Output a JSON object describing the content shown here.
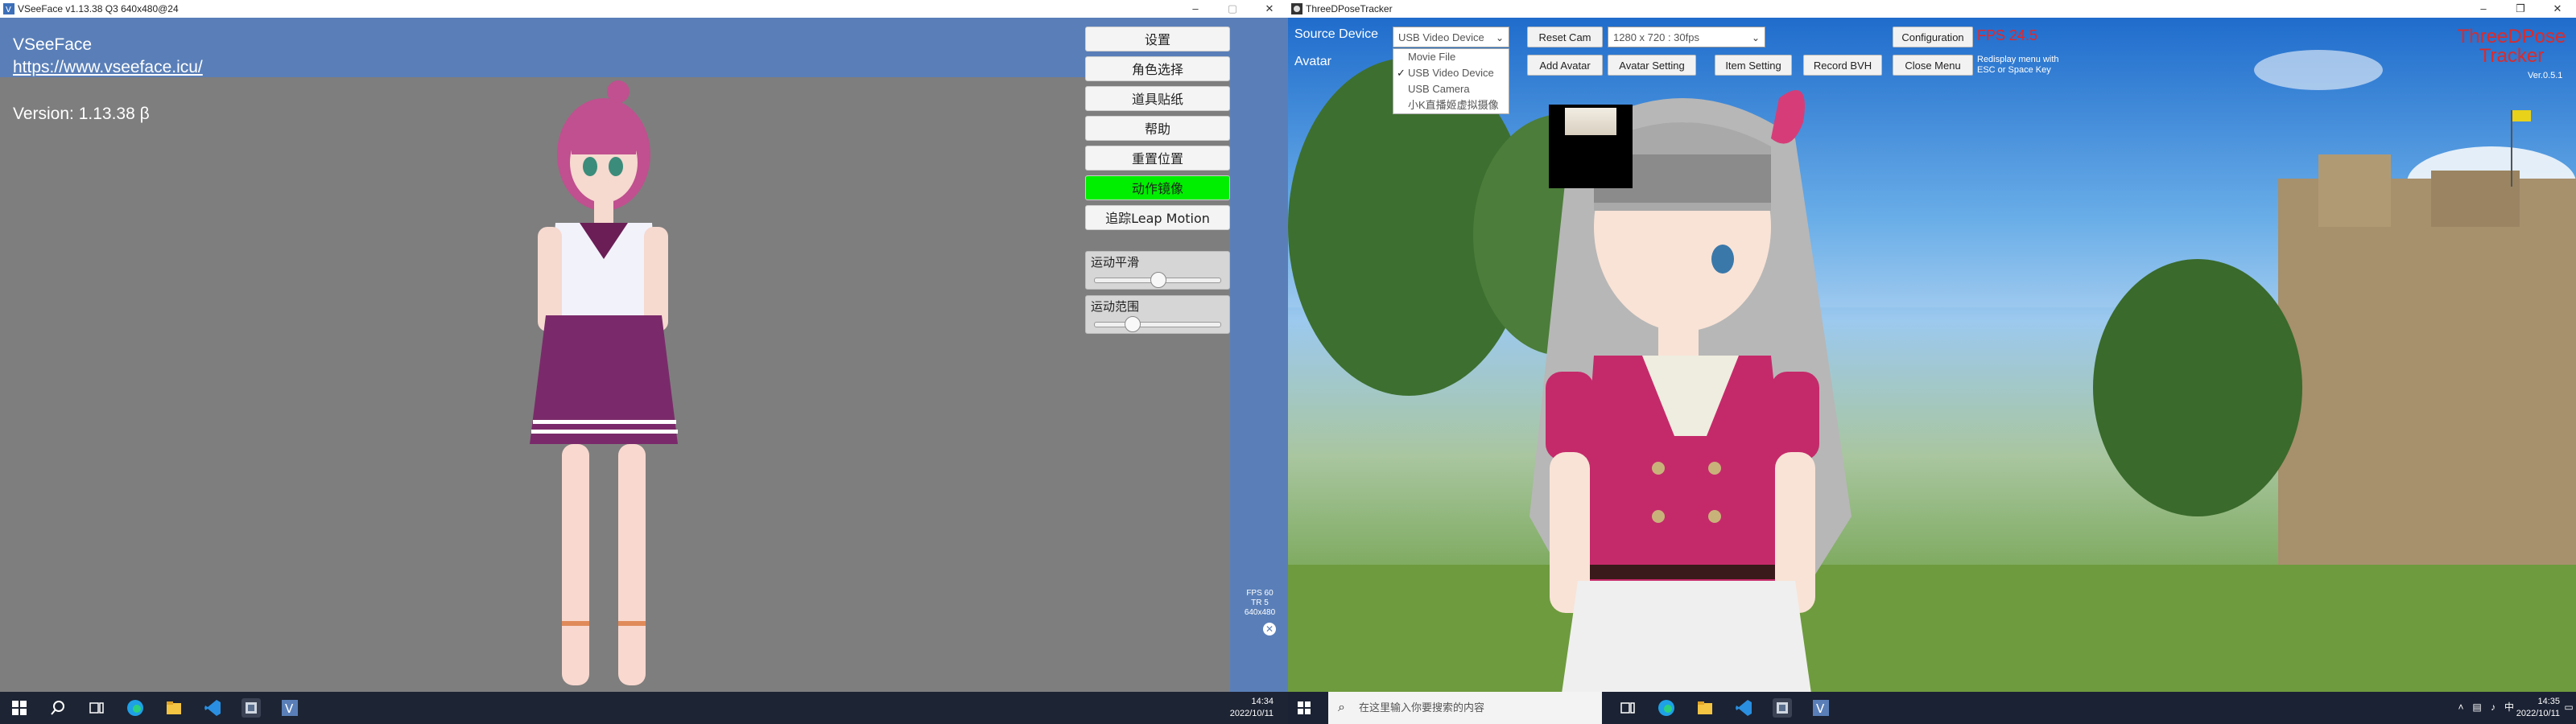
{
  "left_window": {
    "title": "VSeeFace v1.13.38 Q3 640x480@24",
    "brand": "VSeeFace",
    "link": "https://www.vseeface.icu/",
    "version": "Version: 1.13.38 β",
    "buttons": [
      {
        "label": "设置"
      },
      {
        "label": "角色选择"
      },
      {
        "label": "道具贴纸"
      },
      {
        "label": "帮助"
      },
      {
        "label": "重置位置"
      },
      {
        "label": "动作镜像",
        "active": true
      },
      {
        "label": "追踪Leap Motion"
      }
    ],
    "sliders": [
      {
        "label": "运动平滑",
        "value": 0.5
      },
      {
        "label": "运动范围",
        "value": 0.31
      }
    ],
    "stats": {
      "fps": "FPS 60",
      "tr": "TR   5",
      "res": "640x480"
    },
    "header_color": "#5a7fb8",
    "active_button_color": "#00ee00"
  },
  "left_taskbar": {
    "time": "14:34",
    "date": "2022/10/11",
    "icons": [
      "windows-start-icon",
      "search-icon",
      "task-view-icon",
      "edge-icon",
      "file-explorer-icon",
      "vscode-icon",
      "python-app-icon",
      "vseeface-icon"
    ]
  },
  "right_window": {
    "title": "ThreeDPoseTracker",
    "source_label": "Source Device",
    "avatar_label": "Avatar",
    "source_selected": "USB Video Device",
    "source_options": [
      {
        "label": "Movie File",
        "checked": false
      },
      {
        "label": "USB Video Device",
        "checked": true
      },
      {
        "label": "USB Camera",
        "checked": false
      },
      {
        "label": "小K直播姬虚拟摄像",
        "checked": false
      }
    ],
    "resolution_selected": "1280 x 720 : 30fps",
    "buttons": {
      "reset_cam": "Reset Cam",
      "add_avatar": "Add Avatar",
      "avatar_setting": "Avatar Setting",
      "item_setting": "Item Setting",
      "record_bvh": "Record BVH",
      "configuration": "Configuration",
      "close_menu": "Close Menu"
    },
    "fps": "FPS 24.5",
    "redisplay_hint_1": "Redisplay menu with",
    "redisplay_hint_2": "ESC or Space Key",
    "logo_line_1": "ThreeDPose",
    "logo_line_2": "Tracker",
    "version": "Ver.0.5.1",
    "fps_color": "#ee2222"
  },
  "right_taskbar": {
    "search_placeholder": "在这里输入你要搜索的内容",
    "time": "14:35",
    "date": "2022/10/11",
    "tray_lang": "中"
  }
}
